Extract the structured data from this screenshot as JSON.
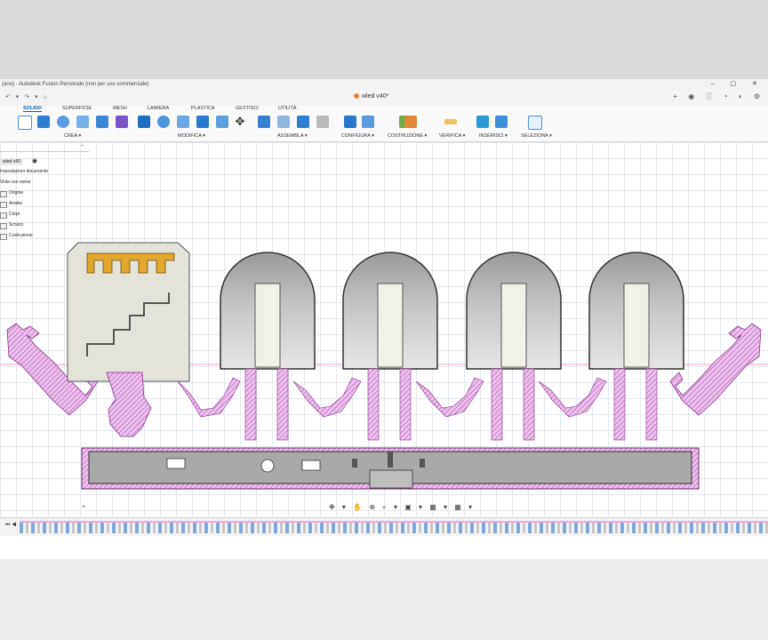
{
  "window": {
    "title": "(ano) - Autodesk Fusion Personale (non per uso commerciale)",
    "controls": "– ▢ ✕"
  },
  "tab": {
    "name": "wled v40*"
  },
  "quick_access": "↶ ▾ ↷ ▾ ⌂",
  "tab_icons": "+ ◉ ⓘ ◔ ◐ ⚙",
  "ribbon": {
    "tabs": [
      "SOLIDO",
      "SUPERFICIE",
      "MESH",
      "LAMIERA",
      "PLASTICA",
      "GESTISCI",
      "UTILITÀ"
    ],
    "active_tab": "SOLIDO",
    "groups": [
      "CREA ▾",
      "MODIFICA ▾",
      "ASSEMBLA ▾",
      "CONFIGURA ▾",
      "COSTRUZIONE ▾",
      "VERIFICA ▾",
      "INSERISCI ▾",
      "SELEZIONA ▾"
    ]
  },
  "browser": {
    "collapse": "–",
    "document": "wled v40",
    "items": [
      "Impostazioni documento",
      "Viste con nome",
      "Origine",
      "Analisi",
      "Corpi",
      "Schizzi",
      "Costruzione"
    ]
  },
  "plus_button": "+",
  "navbar": "✥ ▾ ✋ ⊕ ⌕ ▾ ▣ ▾ ▦ ▾ ▦ ▾",
  "timeline": {
    "play": "⏮ ◀"
  },
  "colors": {
    "accent": "#0a5fb0",
    "sketch": "#e8b6e8",
    "hatch": "#a040a0",
    "body_gray": "#a9a9a9",
    "logo": "#e3a72f"
  }
}
